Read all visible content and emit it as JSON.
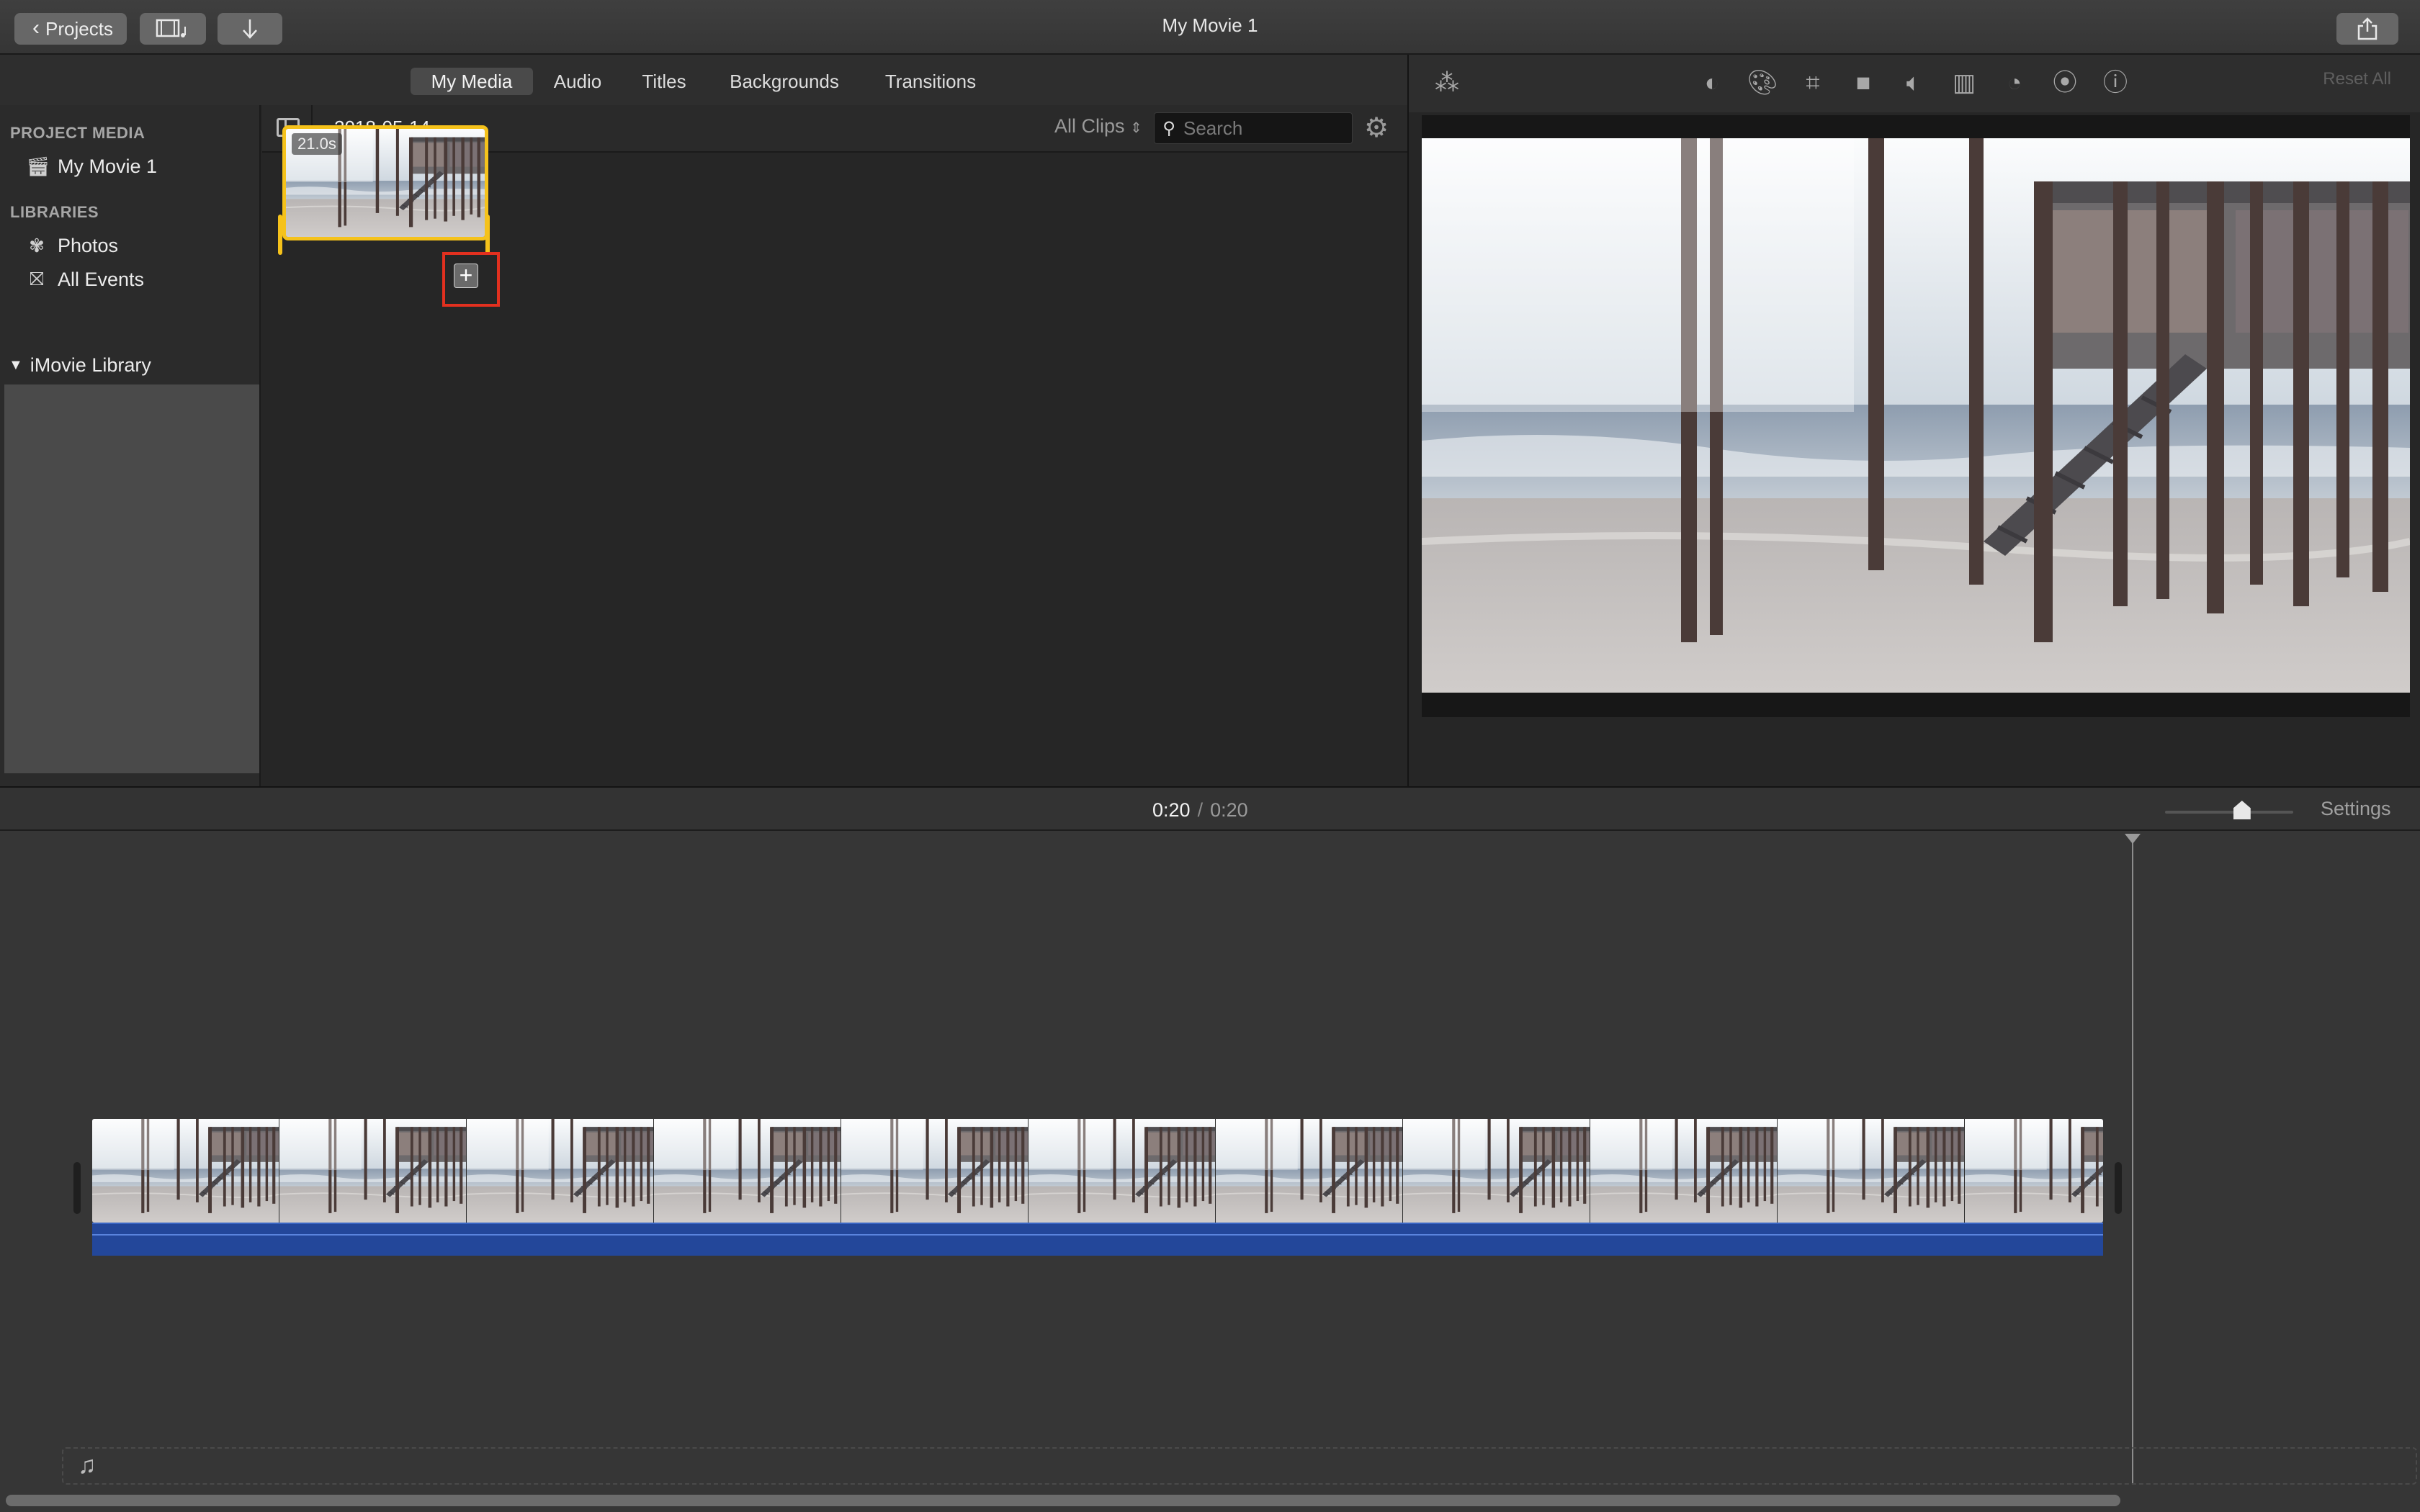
{
  "window": {
    "title": "My Movie 1"
  },
  "toolbar": {
    "projects_label": "Projects",
    "media_icon": "filmstrip-music-icon",
    "import_icon": "arrow-down-icon",
    "share_icon": "share-icon"
  },
  "media_tabs": [
    {
      "label": "My Media",
      "active": true
    },
    {
      "label": "Audio",
      "active": false
    },
    {
      "label": "Titles",
      "active": false
    },
    {
      "label": "Backgrounds",
      "active": false
    },
    {
      "label": "Transitions",
      "active": false
    }
  ],
  "sidebar": {
    "project_media_header": "PROJECT MEDIA",
    "project_item": "My Movie 1",
    "libraries_header": "LIBRARIES",
    "photos": "Photos",
    "all_events": "All Events",
    "library": "iMovie Library"
  },
  "browser": {
    "date": "2018-05-14",
    "filter": "All Clips",
    "search": {
      "placeholder": "Search",
      "value": ""
    },
    "clip": {
      "duration": "21.0s"
    }
  },
  "viewer": {
    "tools": [
      "magic-wand-icon",
      "color-balance-icon",
      "color-correction-icon",
      "crop-icon",
      "stabilization-icon",
      "volume-icon",
      "noise-reduction-icon",
      "speed-icon",
      "clip-filter-icon",
      "info-icon"
    ],
    "reset_all": "Reset All"
  },
  "timeline": {
    "current_time": "0:20",
    "separator": "/",
    "total_time": "0:20",
    "settings_label": "Settings",
    "zoom_level": 0.6,
    "frame_count": 11
  },
  "colors": {
    "selection": "#f5c21b",
    "highlight": "#e2301f",
    "audio": "#23479a"
  }
}
